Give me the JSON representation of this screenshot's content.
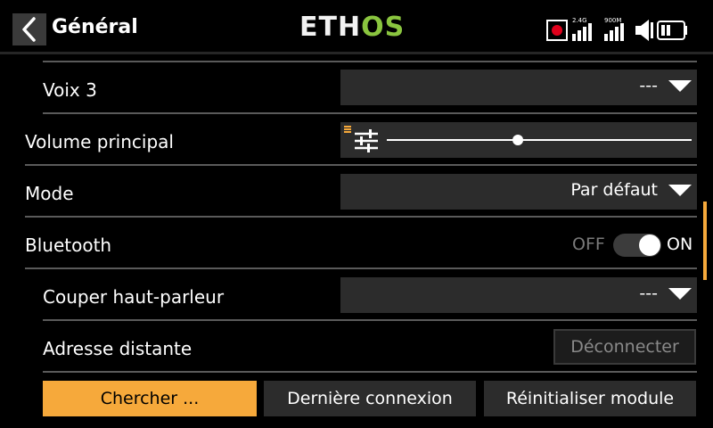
{
  "header": {
    "title": "Général",
    "logo_part1": "ETH",
    "logo_part2": "OS",
    "rf_24g_label": "2.4G",
    "rf_900m_label": "900M"
  },
  "rows": {
    "voice3": {
      "label": "Voix 3",
      "value": "---"
    },
    "main_volume": {
      "label": "Volume principal",
      "level": 0.43
    },
    "mode": {
      "label": "Mode",
      "value": "Par défaut"
    },
    "bluetooth": {
      "label": "Bluetooth",
      "off_label": "OFF",
      "on_label": "ON",
      "state": "on"
    },
    "mute_speaker": {
      "label": "Couper haut-parleur",
      "value": "---"
    },
    "remote_address": {
      "label": "Adresse distante",
      "disconnect_label": "Déconnecter"
    }
  },
  "buttons": {
    "search": "Chercher ...",
    "last_connection": "Dernière connexion",
    "reset_module": "Réinitialiser module"
  },
  "colors": {
    "accent": "#f6a93b",
    "logo_green": "#8ac53f",
    "record_red": "#e0001b"
  }
}
